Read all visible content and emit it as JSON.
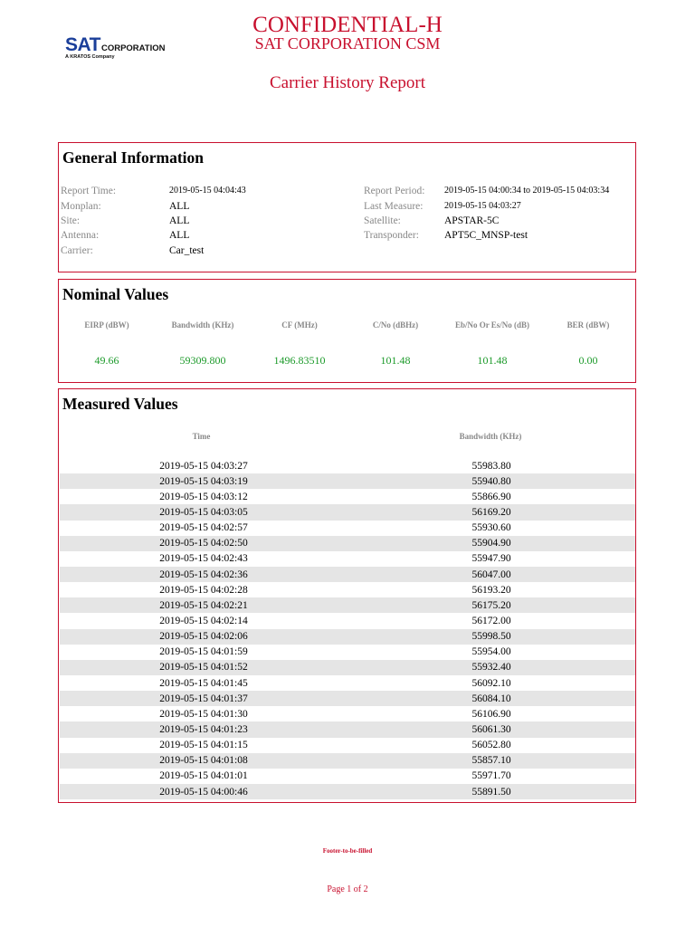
{
  "logo": {
    "brand": "SAT",
    "brand_suffix": "CORPORATION",
    "tagline": "A KRATOS Company"
  },
  "header": {
    "confidential": "CONFIDENTIAL-H",
    "org": "SAT CORPORATION CSM",
    "report_title": "Carrier History Report"
  },
  "general": {
    "title": "General Information",
    "report_time_label": "Report Time:",
    "report_time": "2019-05-15 04:04:43",
    "monplan_label": "Monplan:",
    "monplan": "ALL",
    "site_label": "Site:",
    "site": "ALL",
    "antenna_label": "Antenna:",
    "antenna": "ALL",
    "carrier_label": "Carrier:",
    "carrier": "Car_test",
    "report_period_label": "Report Period:",
    "report_period": "2019-05-15 04:00:34 to 2019-05-15 04:03:34",
    "last_measure_label": "Last Measure:",
    "last_measure": "2019-05-15 04:03:27",
    "satellite_label": "Satellite:",
    "satellite": "APSTAR-5C",
    "transponder_label": "Transponder:",
    "transponder": "APT5C_MNSP-test"
  },
  "nominal": {
    "title": "Nominal Values",
    "headers": [
      "EIRP (dBW)",
      "Bandwidth (KHz)",
      "CF (MHz)",
      "C/No (dBHz)",
      "Eb/No Or Es/No (dB)",
      "BER (dBW)"
    ],
    "values": [
      "49.66",
      "59309.800",
      "1496.83510",
      "101.48",
      "101.48",
      "0.00"
    ]
  },
  "measured": {
    "title": "Measured Values",
    "time_header": "Time",
    "bw_header": "Bandwidth (KHz)",
    "rows": [
      [
        "2019-05-15 04:03:27",
        "55983.80"
      ],
      [
        "2019-05-15 04:03:19",
        "55940.80"
      ],
      [
        "2019-05-15 04:03:12",
        "55866.90"
      ],
      [
        "2019-05-15 04:03:05",
        "56169.20"
      ],
      [
        "2019-05-15 04:02:57",
        "55930.60"
      ],
      [
        "2019-05-15 04:02:50",
        "55904.90"
      ],
      [
        "2019-05-15 04:02:43",
        "55947.90"
      ],
      [
        "2019-05-15 04:02:36",
        "56047.00"
      ],
      [
        "2019-05-15 04:02:28",
        "56193.20"
      ],
      [
        "2019-05-15 04:02:21",
        "56175.20"
      ],
      [
        "2019-05-15 04:02:14",
        "56172.00"
      ],
      [
        "2019-05-15 04:02:06",
        "55998.50"
      ],
      [
        "2019-05-15 04:01:59",
        "55954.00"
      ],
      [
        "2019-05-15 04:01:52",
        "55932.40"
      ],
      [
        "2019-05-15 04:01:45",
        "56092.10"
      ],
      [
        "2019-05-15 04:01:37",
        "56084.10"
      ],
      [
        "2019-05-15 04:01:30",
        "56106.90"
      ],
      [
        "2019-05-15 04:01:23",
        "56061.30"
      ],
      [
        "2019-05-15 04:01:15",
        "56052.80"
      ],
      [
        "2019-05-15 04:01:08",
        "55857.10"
      ],
      [
        "2019-05-15 04:01:01",
        "55971.70"
      ],
      [
        "2019-05-15 04:00:46",
        "55891.50"
      ]
    ]
  },
  "footer": {
    "note": "Footer-to-be-filled",
    "page": "Page 1 of 2"
  },
  "colors": {
    "accent": "#c8102e",
    "value_green": "#1c9a2a",
    "label_gray": "#888888",
    "logo_blue": "#1b3f9a"
  }
}
